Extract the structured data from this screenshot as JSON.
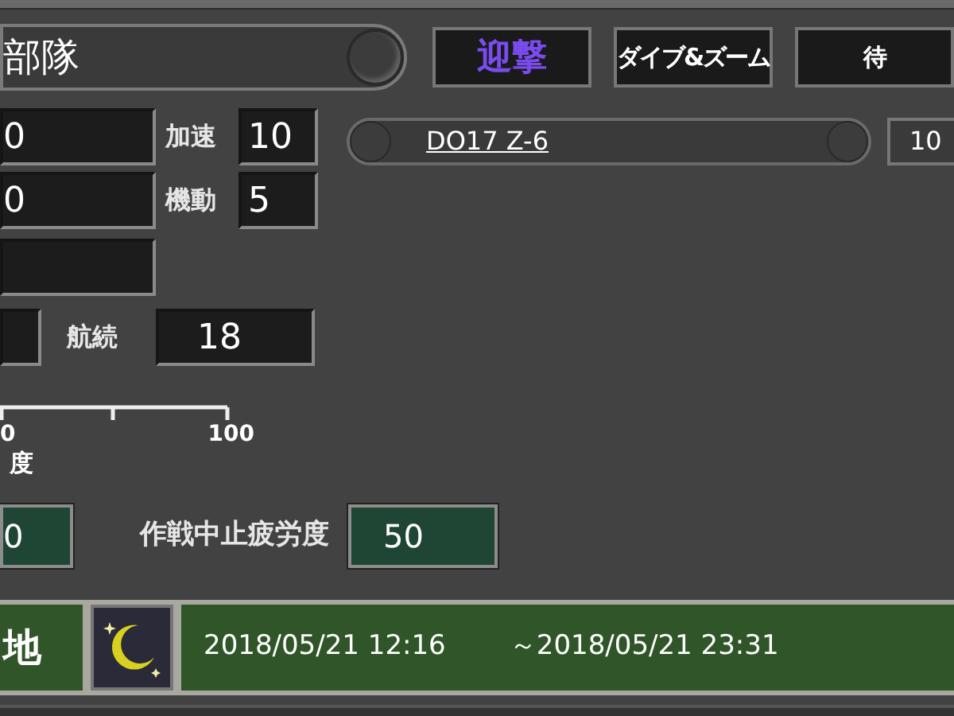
{
  "title": "部隊",
  "modes": [
    {
      "label": "迎撃",
      "selected": true
    },
    {
      "label": "ダイブ&ズーム",
      "selected": false
    },
    {
      "label": "待",
      "selected": false
    }
  ],
  "stats": {
    "field_1": "0",
    "field_2": "0",
    "speed_label": "加速",
    "speed": "10",
    "agility_label": "機動",
    "agility": "5",
    "range_label": "航続",
    "range": "18"
  },
  "aircraft": {
    "name": "DO17 Z-6"
  },
  "count": "10",
  "fatigue_scale": {
    "ticks": [
      "0",
      "100"
    ],
    "label": "度"
  },
  "fatigue": {
    "value_1": "0",
    "stop_label": "作戦中止疲労度",
    "stop_value": "50"
  },
  "status": {
    "location": "地",
    "start": "2018/05/21 12:16",
    "end": "～2018/05/21 23:31"
  }
}
